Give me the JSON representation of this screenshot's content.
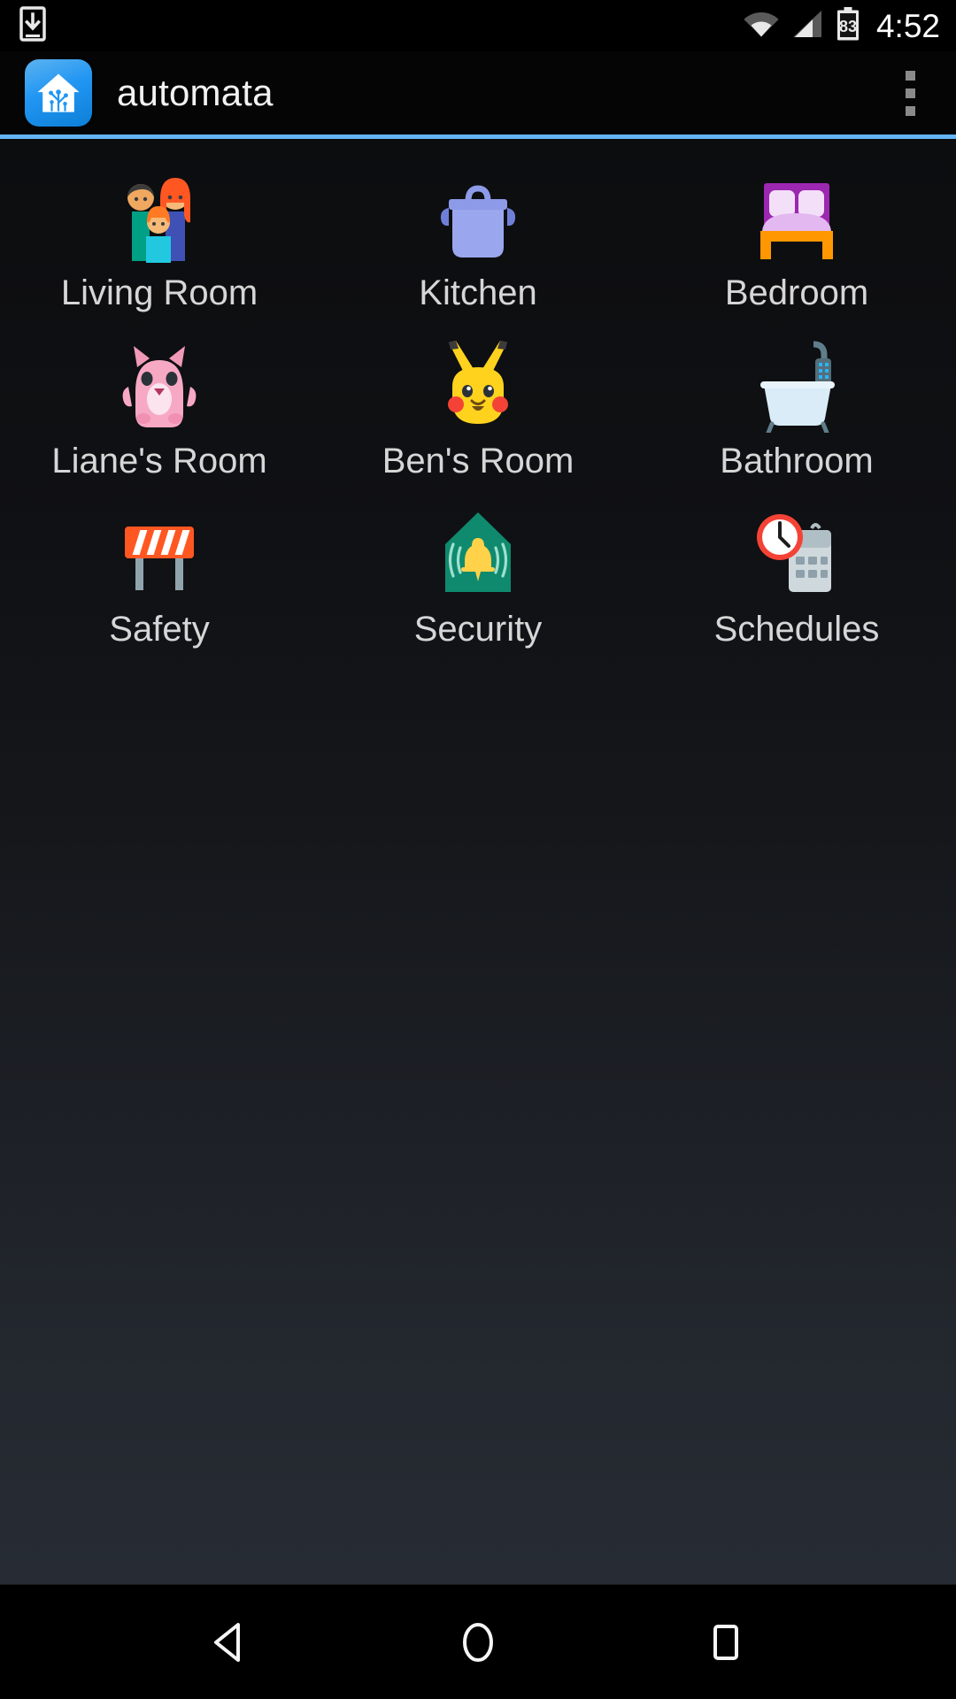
{
  "status_bar": {
    "left_icons": [
      {
        "name": "download-to-device-icon",
        "glyph": "download-phone"
      }
    ],
    "right_icons": [
      {
        "name": "wifi-icon",
        "glyph": "wifi"
      },
      {
        "name": "cellular-signal-icon",
        "glyph": "signal"
      },
      {
        "name": "battery-icon",
        "glyph": "battery",
        "level_text": "83"
      }
    ],
    "battery_level": "83",
    "time": "4:52"
  },
  "app_bar": {
    "logo_name": "home-assistant-logo",
    "title": "automata",
    "overflow_label": "More options",
    "accent_color": "#64b5f6"
  },
  "grid": {
    "tiles": [
      {
        "label": "Living Room",
        "icon": "family-emoji"
      },
      {
        "label": "Kitchen",
        "icon": "cooking-pot-emoji"
      },
      {
        "label": "Bedroom",
        "icon": "bed-emoji"
      },
      {
        "label": "Liane's Room",
        "icon": "pink-cat-emoji"
      },
      {
        "label": "Ben's Room",
        "icon": "pikachu-emoji"
      },
      {
        "label": "Bathroom",
        "icon": "bathtub-emoji"
      },
      {
        "label": "Safety",
        "icon": "construction-barrier-emoji"
      },
      {
        "label": "Security",
        "icon": "house-with-bell-emoji"
      },
      {
        "label": "Schedules",
        "icon": "clock-calendar-emoji"
      }
    ]
  },
  "nav_bar": {
    "back_label": "Back",
    "home_label": "Home",
    "recents_label": "Recent apps"
  },
  "colors": {
    "accent": "#64b5f6",
    "background_top": "#0c0d0f",
    "background_bottom": "#272c34",
    "label_text": "#d6d6d6",
    "title_text": "#f2f2f2"
  }
}
